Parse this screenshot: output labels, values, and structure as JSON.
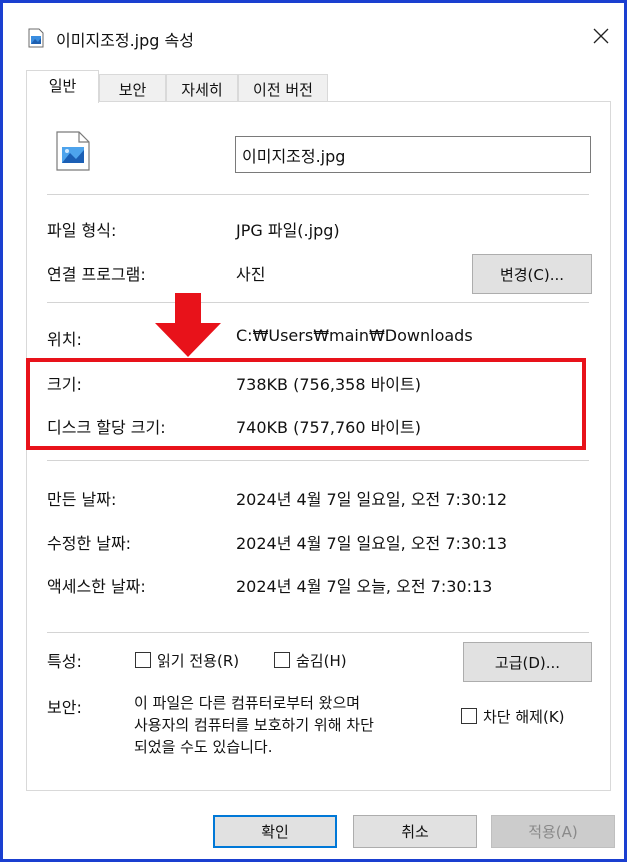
{
  "window": {
    "title": "이미지조정.jpg 속성"
  },
  "tabs": [
    {
      "label": "일반"
    },
    {
      "label": "보안"
    },
    {
      "label": "자세히"
    },
    {
      "label": "이전 버전"
    }
  ],
  "general": {
    "file_name": "이미지조정.jpg",
    "file_type_label": "파일 형식:",
    "file_type_value": "JPG 파일(.jpg)",
    "opens_with_label": "연결 프로그램:",
    "opens_with_value": "사진",
    "change_button": "변경(C)...",
    "location_label": "위치:",
    "location_value": "C:₩Users₩main₩Downloads",
    "size_label": "크기:",
    "size_value": "738KB (756,358 바이트)",
    "size_on_disk_label": "디스크 할당 크기:",
    "size_on_disk_value": "740KB (757,760 바이트)",
    "created_label": "만든 날짜:",
    "created_value": "2024년 4월 7일 일요일, 오전 7:30:12",
    "modified_label": "수정한 날짜:",
    "modified_value": "2024년 4월 7일 일요일, 오전 7:30:13",
    "accessed_label": "액세스한 날짜:",
    "accessed_value": "2024년 4월 7일 오늘, 오전 7:30:13",
    "attributes_label": "특성:",
    "readonly_label": "읽기 전용(R)",
    "hidden_label": "숨김(H)",
    "advanced_button": "고급(D)...",
    "security_label": "보안:",
    "security_line1": "이 파일은 다른 컴퓨터로부터 왔으며",
    "security_line2": "사용자의 컴퓨터를 보호하기 위해 차단",
    "security_line3": "되었을 수도 있습니다.",
    "unblock_label": "차단 해제(K)"
  },
  "footer": {
    "ok": "확인",
    "cancel": "취소",
    "apply": "적용(A)"
  },
  "colors": {
    "highlight_box": "#e8121a",
    "frame_border": "#1a3fd0"
  }
}
